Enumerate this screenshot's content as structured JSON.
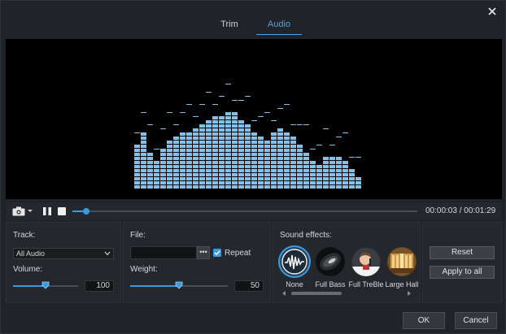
{
  "tabs": [
    {
      "label": "Trim"
    },
    {
      "label": "Audio"
    }
  ],
  "player": {
    "current_time": "00:00:03",
    "total_time": "00:01:29",
    "separator": "/",
    "progress": 0.04
  },
  "track": {
    "label": "Track:",
    "value": "All Audio",
    "volume_label": "Volume:",
    "volume": "100",
    "volume_level": 0.5
  },
  "file": {
    "label": "File:",
    "value": "",
    "browse_label": "•••",
    "repeat_label": "Repeat",
    "repeat_checked": true,
    "weight_label": "Weight:",
    "weight": "50",
    "weight_level": 0.5
  },
  "sound_effects": {
    "label": "Sound effects:",
    "items": [
      {
        "label": "None",
        "icon": "waveform-icon",
        "selected": true
      },
      {
        "label": "Full Bass",
        "icon": "speaker-icon"
      },
      {
        "label": "Full TreBle",
        "icon": "singer-icon"
      },
      {
        "label": "Large Hall",
        "icon": "concert-hall-icon"
      }
    ]
  },
  "actions": {
    "reset_label": "Reset",
    "apply_all_label": "Apply to all"
  },
  "footer": {
    "ok_label": "OK",
    "cancel_label": "Cancel"
  },
  "colors": {
    "accent": "#3a9be0",
    "equalizer": "#7ec2ee",
    "background": "#202327"
  }
}
